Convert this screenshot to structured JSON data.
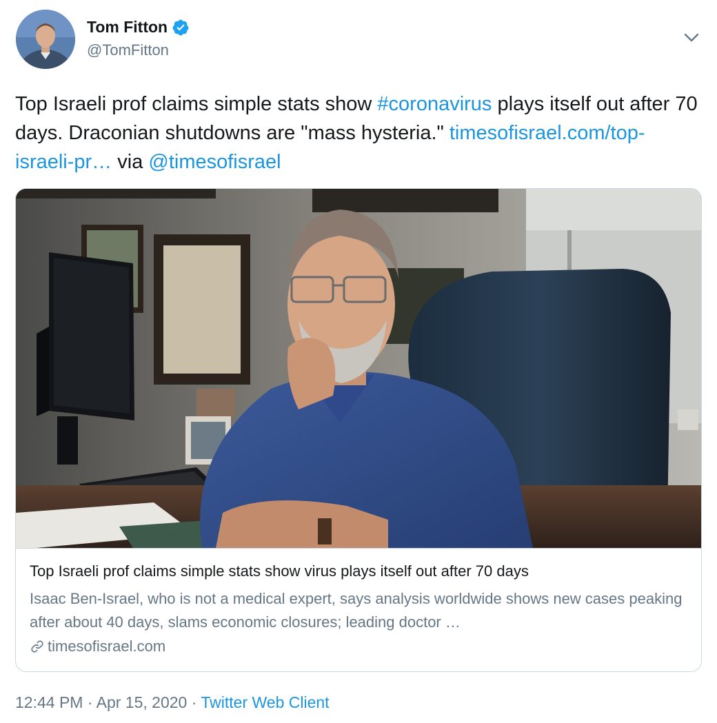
{
  "user": {
    "display_name": "Tom Fitton",
    "handle": "@TomFitton",
    "verified": true,
    "avatar_icon": "profile-photo"
  },
  "tweet": {
    "text_1": "Top Israeli prof claims simple stats show ",
    "hashtag": "#coronavirus",
    "text_2": " plays itself out after 70 days. Draconian shutdowns are \"mass hysteria.\" ",
    "link": "timesofisrael.com/top-israeli-pr…",
    "text_3": " via ",
    "mention": "@timesofisrael"
  },
  "card": {
    "title": "Top Israeli prof claims simple stats show virus plays itself out after 70 days",
    "description": "Isaac Ben-Israel, who is not a medical expert, says analysis worldwide shows new cases peaking after about 40 days, slams economic closures; leading doctor …",
    "domain": "timesofisrael.com",
    "image": "photo of man seated at office desk"
  },
  "meta": {
    "time": "12:44 PM",
    "sep1": " · ",
    "date": "Apr 15, 2020",
    "sep2": " · ",
    "source": "Twitter Web Client"
  },
  "colors": {
    "link": "#1b95e0",
    "secondary": "#657786",
    "primary": "#14171a",
    "border": "#ccd6dd",
    "verified": "#1da1f2"
  }
}
